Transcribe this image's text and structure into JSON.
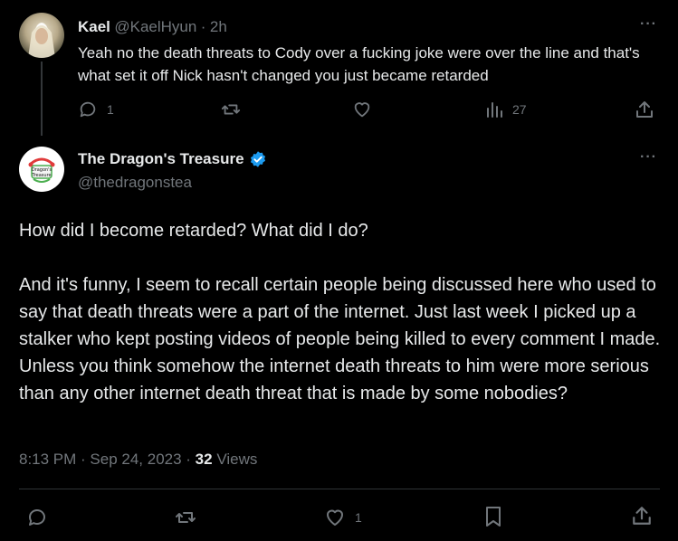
{
  "reply_tweet": {
    "name": "Kael",
    "handle": "@KaelHyun",
    "separator": "·",
    "time": "2h",
    "text": "Yeah no the death threats to Cody over a fucking joke were over the line and that's what set it off Nick hasn't changed you just became retarded",
    "reply_count": "1",
    "views_count": "27"
  },
  "main_tweet": {
    "name": "The Dragon's Treasure",
    "handle": "@thedragonstea",
    "avatar_text": "Dragon's Treasure",
    "paragraph1": "How did I become retarded? What did I do?",
    "paragraph2": "And it's funny, I seem to recall certain people being discussed here who used to say that death threats were a part of the internet. Just last week I picked up a stalker who kept posting videos of people being killed to every comment I made. Unless you think somehow the internet death threats to him were more serious than any other internet death threat that is made by some nobodies?",
    "timestamp": "8:13 PM · Sep 24, 2023 · ",
    "views_count": "32",
    "views_label": " Views",
    "like_count": "1"
  },
  "colors": {
    "background": "#000000",
    "text": "#e7e9ea",
    "muted": "#71767b",
    "verified": "#1d9bf0",
    "divider": "#2f3336"
  }
}
